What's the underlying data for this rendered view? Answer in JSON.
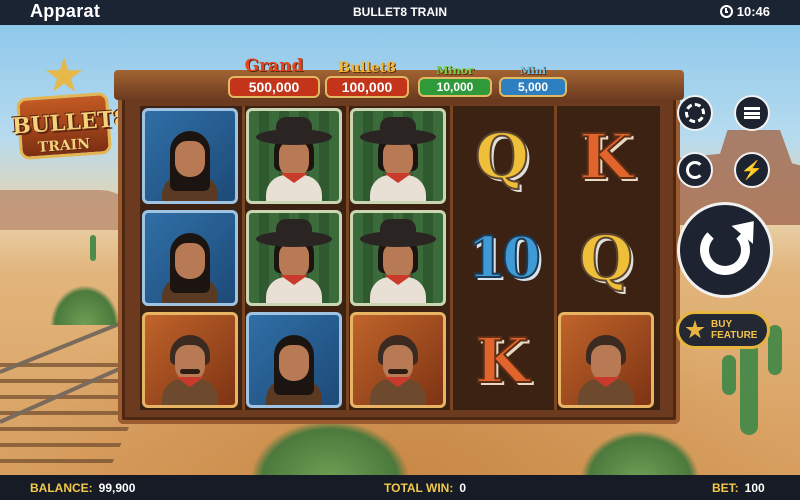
{
  "topbar": {
    "brand": "Apparat",
    "game_title": "BULLET8 TRAIN",
    "clock": "10:46"
  },
  "logo": {
    "line1": "BULLET8",
    "line2": "TRAIN"
  },
  "jackpots": [
    {
      "label": "Grand",
      "value": "500,000",
      "label_color": "#e8431c",
      "box_color": "#c3341b"
    },
    {
      "label": "Bullet8",
      "value": "100,000",
      "label_color": "#f2b83a",
      "box_color": "#c3341b"
    },
    {
      "label": "Minor",
      "value": "10,000",
      "label_color": "#7bd04a",
      "box_color": "#2f9a3a"
    },
    {
      "label": "Mini",
      "value": "5,000",
      "label_color": "#6bc3ea",
      "box_color": "#2e7fc0"
    }
  ],
  "reels": [
    [
      "native",
      "native",
      "outlaw"
    ],
    [
      "cowgirl",
      "cowgirl",
      "native"
    ],
    [
      "cowgirl",
      "cowgirl",
      "outlaw"
    ],
    [
      "Q",
      "10",
      "K"
    ],
    [
      "K",
      "Q",
      "gunslinger"
    ]
  ],
  "controls": {
    "bet_settings_icon": "chip-icon",
    "menu_icon": "menu-icon",
    "autoplay_icon": "autoplay-icon",
    "turbo_icon": "lightning-icon",
    "spin_icon": "spin-icon",
    "buy_feature_line1": "BUY",
    "buy_feature_line2": "FEATURE"
  },
  "bottombar": {
    "balance_label": "BALANCE:",
    "balance_value": "99,900",
    "total_win_label": "TOTAL WIN:",
    "total_win_value": "0",
    "bet_label": "BET:",
    "bet_value": "100"
  },
  "colors": {
    "topbar": "#1b2433",
    "accent_gold": "#f2c94c",
    "frame_wood": "#6b3a1f"
  }
}
